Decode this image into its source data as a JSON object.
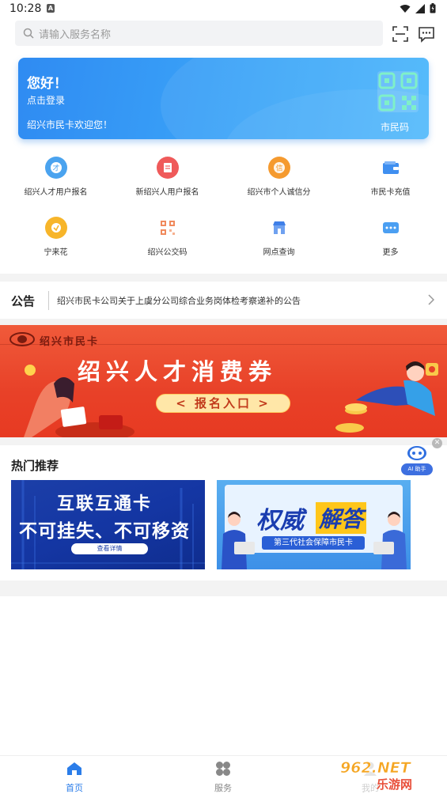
{
  "status_bar": {
    "time": "10:28",
    "badge": "A"
  },
  "search": {
    "placeholder": "请输入服务名称"
  },
  "card": {
    "greeting": "您好！",
    "login": "点击登录",
    "welcome": "绍兴市民卡欢迎您！",
    "qr_label": "市民码"
  },
  "grid": [
    {
      "label": "绍兴人才用户报名",
      "icon": "talent-user-icon",
      "color": "#4aa3ef"
    },
    {
      "label": "新绍兴人用户报名",
      "icon": "register-icon",
      "color": "#ef5a5a"
    },
    {
      "label": "绍兴市个人诚信分",
      "icon": "credit-icon",
      "color": "#f59a2f"
    },
    {
      "label": "市民卡充值",
      "icon": "wallet-icon",
      "color": "#3f8ff0"
    },
    {
      "label": "宁来花",
      "icon": "ninglaihua-icon",
      "color": "#f7b52a"
    },
    {
      "label": "绍兴公交码",
      "icon": "bus-qr-icon",
      "color": "#f08a5d"
    },
    {
      "label": "网点查询",
      "icon": "store-icon",
      "color": "#3f7fe8"
    },
    {
      "label": "更多",
      "icon": "more-icon",
      "color": "#4b9ff2"
    }
  ],
  "notice": {
    "title": "公告",
    "text": "绍兴市民卡公司关于上虞分公司综合业务岗体检考察递补的公告"
  },
  "banner": {
    "logo_text": "绍兴市民卡",
    "headline": "绍兴人才消费券",
    "cta": "< 报名入口 >"
  },
  "hot": {
    "title": "热门推荐",
    "ai_label": "AI 助手",
    "cards": [
      {
        "line1": "互联互通卡",
        "line2": "不可挂失、不可移资",
        "button": "查看详情"
      },
      {
        "part1": "权威",
        "part2": "解答",
        "strip": "第三代社会保障市民卡"
      }
    ]
  },
  "bottom_nav": [
    {
      "label": "首页",
      "active": true
    },
    {
      "label": "服务",
      "active": false
    },
    {
      "label": "我的",
      "active": false
    }
  ],
  "watermark": {
    "text1": "962.NET",
    "text2": "乐游网"
  },
  "colors": {
    "accent": "#2b7de9",
    "card_start": "#2f8bf2",
    "card_end": "#4ab6fb",
    "banner_red": "#e84128"
  }
}
